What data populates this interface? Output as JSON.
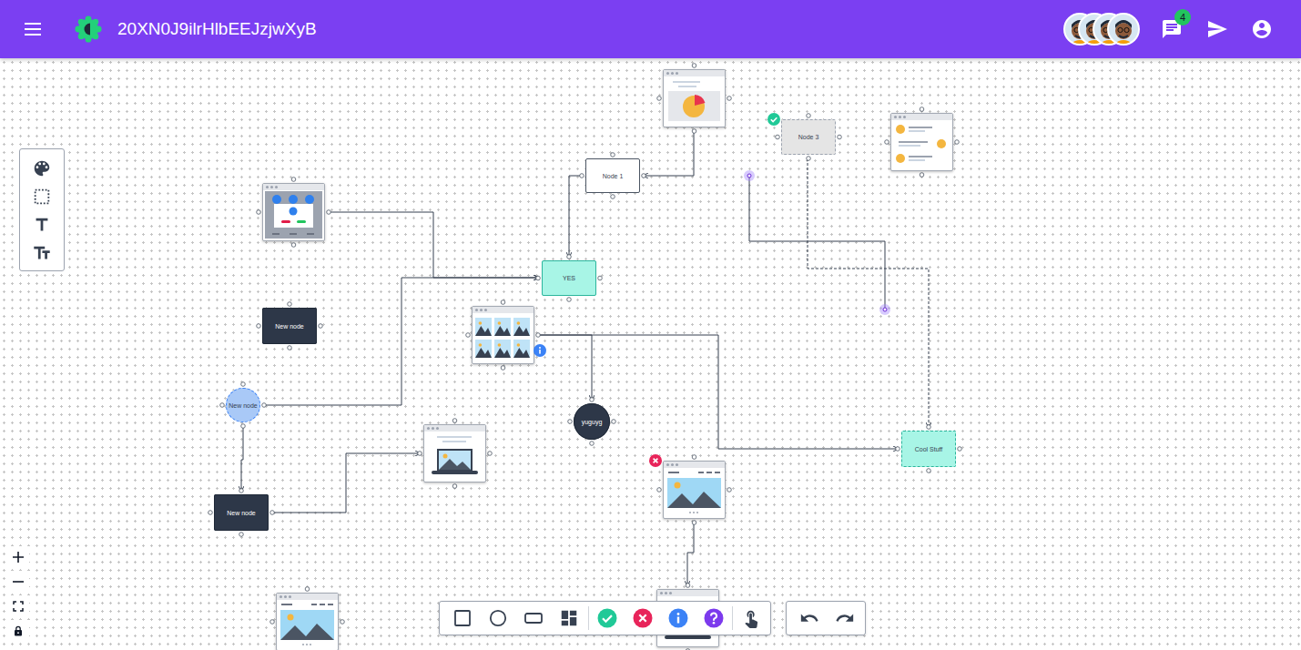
{
  "header": {
    "title": "20XN0J9ilrHlbEEJzjwXyB",
    "notifications": "4"
  },
  "nodes": [
    {
      "kind": "image"
    },
    {
      "kind": "rect",
      "label": "Node 1",
      "color": "#ffffff",
      "dashed": false
    },
    {
      "kind": "rect",
      "label": "Node 3",
      "color": "#e5e5e5",
      "dashed": true,
      "badge": "check"
    },
    {
      "kind": "image"
    },
    {
      "kind": "image"
    },
    {
      "kind": "rect",
      "label": "YES",
      "color": "#a8f5e6",
      "dashed": false
    },
    {
      "kind": "rect",
      "label": "New node",
      "color": "#2d3748",
      "dashed": false
    },
    {
      "kind": "image",
      "badge": "info"
    },
    {
      "kind": "circle",
      "label": "New node",
      "color": "#a9c9f7",
      "dashed": true
    },
    {
      "kind": "circle",
      "label": "yuguyg",
      "color": "#2d3748",
      "dashed": false
    },
    {
      "kind": "image"
    },
    {
      "kind": "rect",
      "label": "Cool Stuff",
      "color": "#a8f5e6",
      "dashed": true
    },
    {
      "kind": "image",
      "badge": "error"
    },
    {
      "kind": "rect",
      "label": "New node",
      "color": "#2d3748",
      "dashed": false
    },
    {
      "kind": "image"
    },
    {
      "kind": "image"
    }
  ],
  "edges": [
    {
      "kind": "solid"
    },
    {
      "kind": "solid"
    },
    {
      "kind": "solid"
    },
    {
      "kind": "solid"
    },
    {
      "kind": "solid"
    },
    {
      "kind": "solid"
    },
    {
      "kind": "dashed"
    },
    {
      "kind": "loose"
    },
    {
      "kind": "solid"
    },
    {
      "kind": "solid"
    },
    {
      "kind": "solid"
    }
  ]
}
